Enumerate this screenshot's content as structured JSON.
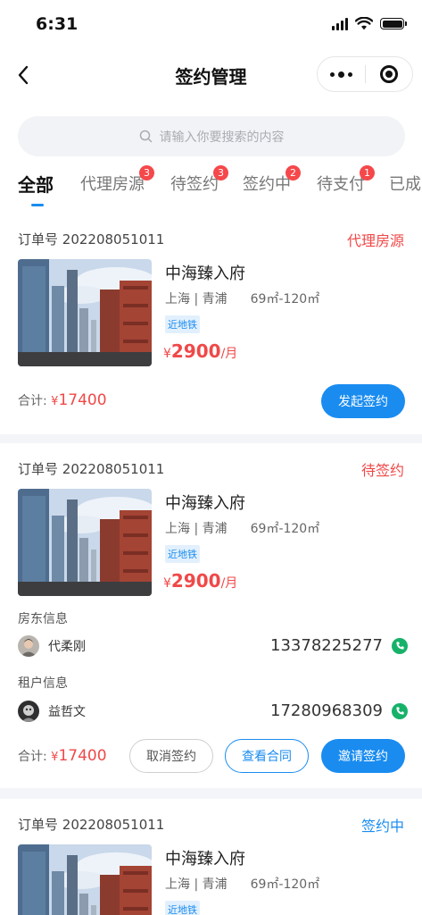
{
  "status_bar": {
    "time": "6:31"
  },
  "nav": {
    "title": "签约管理"
  },
  "search": {
    "placeholder": "请输入你要搜索的内容"
  },
  "tabs": [
    {
      "label": "全部",
      "badge": ""
    },
    {
      "label": "代理房源",
      "badge": "3"
    },
    {
      "label": "待签约",
      "badge": "3"
    },
    {
      "label": "签约中",
      "badge": "2"
    },
    {
      "label": "待支付",
      "badge": "1"
    },
    {
      "label": "已成",
      "badge": ""
    }
  ],
  "colors": {
    "accent": "#1a8cf0",
    "price": "#f04848",
    "badge": "#f5484b",
    "phone": "#17b26a"
  },
  "orders": [
    {
      "order_label": "订单号",
      "order_no": "202208051011",
      "status": "代理房源",
      "status_color": "#f04848",
      "name": "中海臻入府",
      "city": "上海",
      "district": "青浦",
      "area": "69㎡-120㎡",
      "tag": "近地铁",
      "price_cur": "¥",
      "price": "2900",
      "price_unit": "/月",
      "total_label": "合计:",
      "total_cur": "¥",
      "total": "17400",
      "buttons": [
        "发起签约"
      ]
    },
    {
      "order_label": "订单号",
      "order_no": "202208051011",
      "status": "待签约",
      "status_color": "#f04848",
      "name": "中海臻入府",
      "city": "上海",
      "district": "青浦",
      "area": "69㎡-120㎡",
      "tag": "近地铁",
      "price_cur": "¥",
      "price": "2900",
      "price_unit": "/月",
      "landlord_label": "房东信息",
      "landlord_name": "代柔刚",
      "landlord_phone": "13378225277",
      "tenant_label": "租户信息",
      "tenant_name": "益哲文",
      "tenant_phone": "17280968309",
      "total_label": "合计:",
      "total_cur": "¥",
      "total": "17400",
      "buttons": [
        "取消签约",
        "查看合同",
        "邀请签约"
      ]
    },
    {
      "order_label": "订单号",
      "order_no": "202208051011",
      "status": "签约中",
      "status_color": "#1a8cf0",
      "name": "中海臻入府",
      "city": "上海",
      "district": "青浦",
      "area": "69㎡-120㎡",
      "tag": "近地铁"
    }
  ]
}
